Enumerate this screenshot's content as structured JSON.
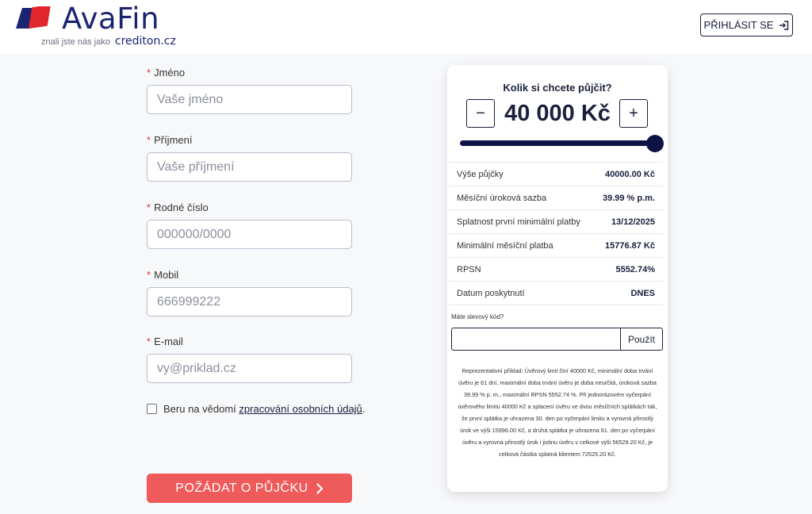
{
  "header": {
    "logo_text": "AvaFin",
    "logo_sub": "znali jste nás jako",
    "logo_sub_brand": "crediton.cz",
    "login_label": "PŘIHLÁSIT SE",
    "login_icon": "sign-in-icon"
  },
  "form": {
    "required_mark": "*",
    "fields": [
      {
        "label": "Jméno",
        "placeholder": "Vaše jméno"
      },
      {
        "label": "Příjmení",
        "placeholder": "Vaše příjmení"
      },
      {
        "label": "Rodné číslo",
        "placeholder": "000000/0000"
      },
      {
        "label": "Mobil",
        "placeholder": "666999222"
      },
      {
        "label": "E-mail",
        "placeholder": "vy@priklad.cz"
      }
    ],
    "consent_prefix": "Beru na vědomí",
    "consent_link": "zpracování osobních údajů",
    "consent_suffix": ".",
    "submit_label": "POŽÁDAT O PŮJČKU",
    "submit_icon": "chevron-right-icon"
  },
  "calculator": {
    "title": "Kolik si chcete půjčit?",
    "minus_label": "−",
    "plus_label": "+",
    "amount": "40 000 Kč",
    "slider_fraction": 1.0,
    "rows": [
      {
        "label": "Výše půjčky",
        "value": "40000.00 Kč"
      },
      {
        "label": "Měsíční úroková sazba",
        "value": "39.99 % p.m."
      },
      {
        "label": "Splatnost první minimální platby",
        "value": "13/12/2025"
      },
      {
        "label": "Minimální měsíční platba",
        "value": "15776.87 Kč"
      },
      {
        "label": "RPSN",
        "value": "5552.74%"
      },
      {
        "label": "Datum poskytnutí",
        "value": "DNES"
      }
    ],
    "promo_label": "Máte slevový kód?",
    "promo_value": "",
    "promo_button": "Použít",
    "representative_example": "Reprezentativní příklad: Úvěrový limit činí 40000 Kč, minimální doba trvání úvěru je 61 dní, maximální doba trvání úvěru je doba neurčitá, úroková sazba 39.99 % p. m., maximální RPSN 5552.74 %. Při jednorázovém vyčerpání úvěrového limitu 40000 Kč a splacení úvěru ve dvou měsíčních splátkách tak, že první splátka je uhrazena 30. den po vyčerpání limitu a vyrovná přirostlý úrok ve výši 15996.00 Kč, a druhá splátka je uhrazena 61. den po vyčerpání úvěru a vyrovná přirostlý úrok i jistinu úvěru v celkové výši 56529.20 Kč, je celková částka splatná klientem 72525.20 Kč."
  },
  "colors": {
    "brand_navy": "#1b2470",
    "slider": "#0e1347",
    "submit": "#ef5a5a",
    "required": "#e23b3b"
  }
}
